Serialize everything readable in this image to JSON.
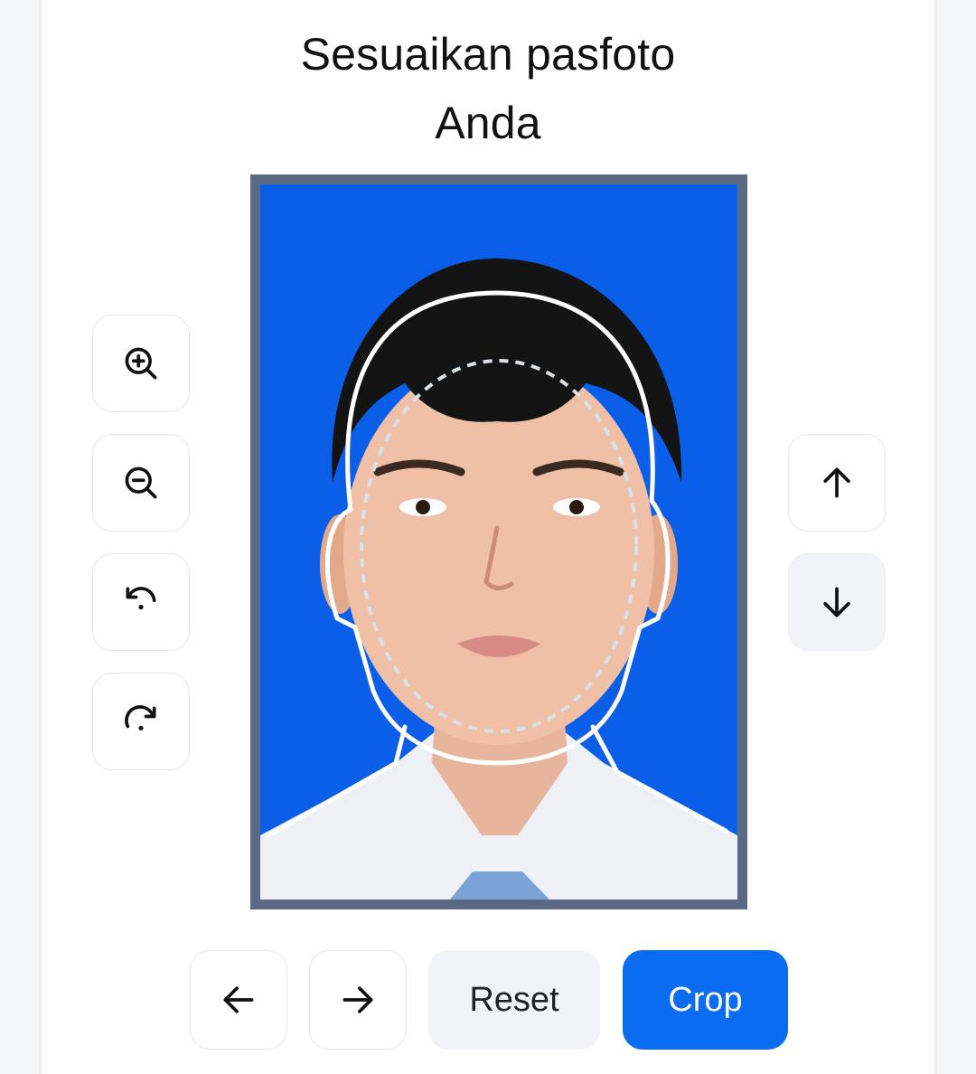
{
  "dialog": {
    "title_line1": "Sesuaikan pasfoto",
    "title_line2": "Anda"
  },
  "tools_left": [
    {
      "name": "zoom-in",
      "icon": "zoom-in-icon"
    },
    {
      "name": "zoom-out",
      "icon": "zoom-out-icon"
    },
    {
      "name": "rotate-left",
      "icon": "rotate-left-icon"
    },
    {
      "name": "rotate-right",
      "icon": "rotate-right-icon"
    }
  ],
  "tools_right": [
    {
      "name": "move-up",
      "icon": "arrow-up-icon"
    },
    {
      "name": "move-down",
      "icon": "arrow-down-icon"
    }
  ],
  "bottom_bar": {
    "left_icon": "arrow-left-icon",
    "right_icon": "arrow-right-icon",
    "reset_label": "Reset",
    "crop_label": "Crop"
  },
  "photo": {
    "background_color": "#0a5ee8",
    "frame_color": "#5a6a84",
    "guide_color": "#ffffff"
  },
  "colors": {
    "accent": "#0a6cf0",
    "muted_button": "#f1f3f6"
  }
}
